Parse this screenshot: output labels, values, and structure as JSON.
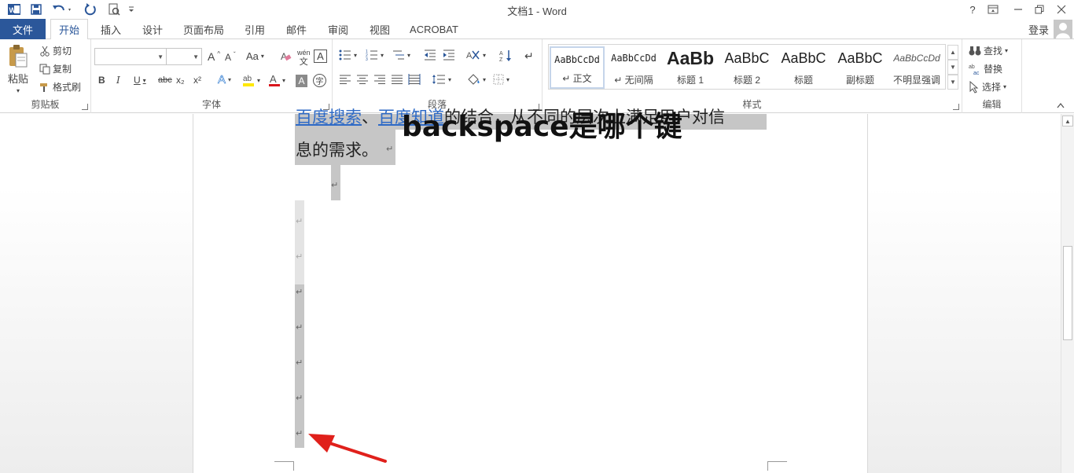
{
  "window": {
    "title": "文档1 - Word",
    "help": "?",
    "restore_ribbon": "⧉",
    "minimize": "─",
    "maximize": "🗗",
    "close": "✕"
  },
  "quick_access": {
    "app_icon": "W",
    "save_icon": "save-icon",
    "undo_icon": "undo-icon",
    "redo_icon": "redo-icon",
    "preview_icon": "print-preview-icon",
    "customize_icon": "customize-arrow-icon"
  },
  "tabs": {
    "file": "文件",
    "items": [
      "开始",
      "插入",
      "设计",
      "页面布局",
      "引用",
      "邮件",
      "审阅",
      "视图",
      "ACROBAT"
    ],
    "active": "开始",
    "login": "登录"
  },
  "clipboard": {
    "paste": "粘贴",
    "cut": "剪切",
    "copy": "复制",
    "format_painter": "格式刷",
    "label": "剪贴板"
  },
  "font": {
    "font_name": "",
    "font_size": "",
    "grow": "A",
    "shrink": "A",
    "case": "Aa",
    "clear": "clear-format-icon",
    "phonetic": "wén",
    "border_char": "A",
    "bold": "B",
    "italic": "I",
    "underline": "U",
    "strikethrough": "abc",
    "subscript": "x₂",
    "superscript": "x²",
    "text_effects": "A",
    "highlight": "ab",
    "font_color": "A",
    "char_shading": "A",
    "enclose": "字",
    "label": "字体"
  },
  "paragraph": {
    "label": "段落"
  },
  "styles": {
    "items": [
      {
        "sample": "AaBbCcDd",
        "name": "↵ 正文"
      },
      {
        "sample": "AaBbCcDd",
        "name": "↵ 无间隔"
      },
      {
        "sample": "AaBb",
        "name": "标题 1"
      },
      {
        "sample": "AaBbC",
        "name": "标题 2"
      },
      {
        "sample": "AaBbC",
        "name": "标题"
      },
      {
        "sample": "AaBbC",
        "name": "副标题"
      },
      {
        "sample": "AaBbCcDd",
        "name": "不明显强调"
      }
    ],
    "label": "样式"
  },
  "editing": {
    "find": "查找",
    "replace": "替换",
    "select": "选择",
    "label": "编辑"
  },
  "document": {
    "line1_link1": "百度搜索",
    "line1_sep": "、",
    "line1_link2": "百度知道",
    "line1_rest": "的结合，从不同的层次上满足用户对信",
    "line2": "息的需求。",
    "para_mark": "↵",
    "heading": "backspace是哪个键"
  },
  "colors": {
    "accent": "#2b579a",
    "selection": "#c6c6c6",
    "link": "#2e6ac6",
    "arrow": "#e0201b"
  }
}
